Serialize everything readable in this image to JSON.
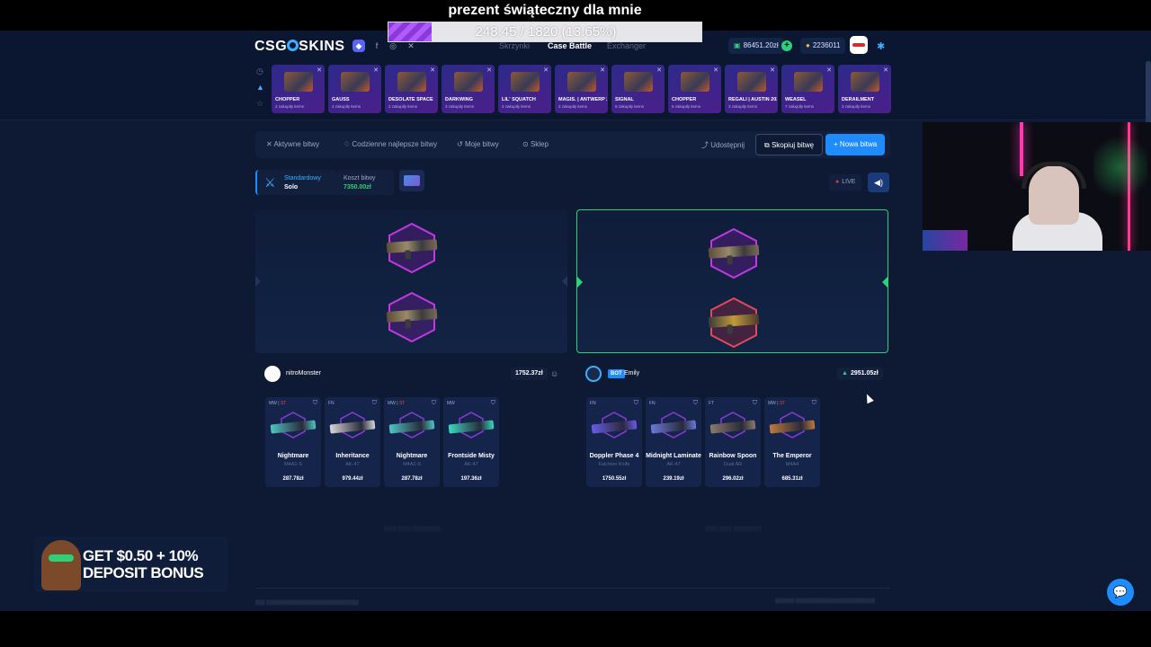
{
  "overlay": {
    "goal_title": "prezent świąteczny dla mnie",
    "goal_progress": "248.45 / 1820 (13.65%)",
    "goal_fraction": 0.1365
  },
  "header": {
    "logo_text_left": "CSG",
    "logo_text_right": "SKINS",
    "nav": [
      "Skrzynki",
      "Case Battle",
      "Exchanger"
    ],
    "balance_cash": "86451.20zł",
    "balance_coins": "2236011"
  },
  "cases": [
    {
      "name": "CHOPPER",
      "sub": "2 zakupiły items"
    },
    {
      "name": "GAUSS",
      "sub": "4 zakupiły items"
    },
    {
      "name": "DESOLATE SPACE",
      "sub": "2 zakupiły items"
    },
    {
      "name": "DARKWING",
      "sub": "3 zakupiły items"
    },
    {
      "name": "LIL' SQUATCH",
      "sub": "2 zakupiły items"
    },
    {
      "name": "MAGIS. | ANTWERP 2022",
      "sub": "2 zakupiły items"
    },
    {
      "name": "SIGNAL",
      "sub": "5 zakupiły items"
    },
    {
      "name": "CHOPPER",
      "sub": "5 zakupiły items"
    },
    {
      "name": "REGALI | AUSTIN 2025",
      "sub": "3 zakupiły items"
    },
    {
      "name": "WEASEL",
      "sub": "7 zakupiły items"
    },
    {
      "name": "DERAILMENT",
      "sub": "3 zakupiły items"
    }
  ],
  "toolbar": {
    "tabs": [
      "Aktywne bitwy",
      "Codzienne najlepsze bitwy",
      "Moje bitwy",
      "Sklep"
    ],
    "share": "Udostępnij",
    "copy": "Skopiuj bitwę",
    "new": "+ Nowa bitwa"
  },
  "battle": {
    "mode_title": "Standardowy",
    "mode_sub": "Solo",
    "cost_label": "Koszt bitwy",
    "cost_value": "7350.00zł",
    "live": "LIVE"
  },
  "players": [
    {
      "name": "nitroMonster",
      "total": "1752.37zł",
      "items": [
        {
          "cond": "MW",
          "st": "ST",
          "name": "Nightmare",
          "weapon": "M4A1-S",
          "price": "287.78zł",
          "color": "#4ec6c0"
        },
        {
          "cond": "FN",
          "st": "",
          "name": "Inheritance",
          "weapon": "AK-47",
          "price": "979.44zł",
          "color": "#d8d8d8"
        },
        {
          "cond": "MW",
          "st": "ST",
          "name": "Nightmare",
          "weapon": "M4A1-S",
          "price": "287.78zł",
          "color": "#4ec6c0"
        },
        {
          "cond": "MW",
          "st": "",
          "name": "Frontside Misty",
          "weapon": "AK-47",
          "price": "197.36zł",
          "color": "#3ad8c0"
        }
      ]
    },
    {
      "name": "Emily",
      "badge": "BOT",
      "total": "2951.05zł",
      "items": [
        {
          "cond": "FN",
          "st": "",
          "name": "Doppler Phase 4",
          "weapon": "Falchion Knife",
          "price": "1750.55zł",
          "color": "#6a5ae8"
        },
        {
          "cond": "FN",
          "st": "",
          "name": "Midnight Laminate",
          "weapon": "AK-47",
          "price": "239.19zł",
          "color": "#6a7ad8"
        },
        {
          "cond": "FT",
          "st": "",
          "name": "Rainbow Spoon",
          "weapon": "Dual AR",
          "price": "296.02zł",
          "color": "#8a7a6a"
        },
        {
          "cond": "MW",
          "st": "ST",
          "name": "The Emperor",
          "weapon": "M4A4",
          "price": "685.31zł",
          "color": "#c07a3a"
        }
      ]
    }
  ],
  "ad": {
    "line1": "GET $0.50 + 10%",
    "line2": "DEPOSIT BONUS"
  },
  "colors": {
    "accent": "#1e8cff",
    "winner": "#2fd07a",
    "background": "#0e1a33"
  }
}
